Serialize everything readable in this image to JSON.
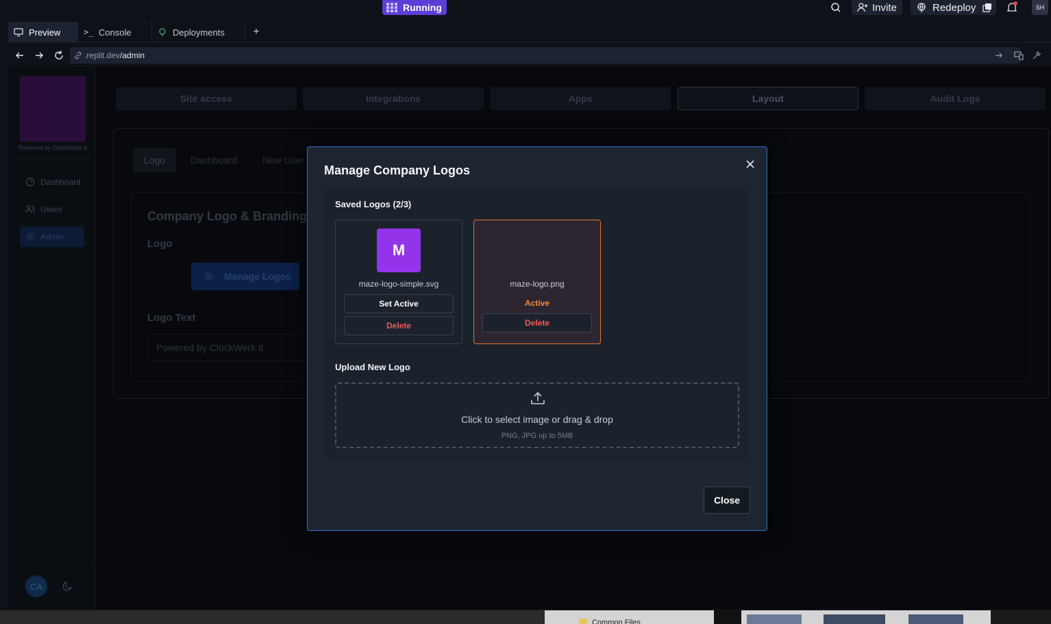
{
  "topbar": {
    "run_label": "Running",
    "invite_label": "Invite",
    "redeploy_label": "Redeploy",
    "avatar_initials": "SH"
  },
  "tabs": [
    {
      "label": "Preview",
      "icon": "monitor-icon"
    },
    {
      "label": "Console",
      "icon": "terminal-icon"
    },
    {
      "label": "Deployments",
      "icon": "deploy-icon"
    }
  ],
  "address": {
    "url_prefix": ".replit.dev",
    "url_path": "/admin"
  },
  "app": {
    "logo_caption": "Powered by ClockWerk.it",
    "nav": [
      {
        "label": "Dashboard"
      },
      {
        "label": "Users"
      },
      {
        "label": "Admin"
      }
    ],
    "admin_tabs": [
      "Site access",
      "Integrations",
      "Apps",
      "Layout",
      "Audit Logs"
    ],
    "layout_subtabs": [
      "Logo",
      "Dashboard",
      "New User"
    ],
    "branding_title": "Company Logo & Branding",
    "logo_heading": "Logo",
    "manage_logos_label": "Manage Logos",
    "logo_text_heading": "Logo Text",
    "logo_text_value": "Powered by ClockWerk.it",
    "user_initials": "CA"
  },
  "modal": {
    "title": "Manage Company Logos",
    "saved_heading": "Saved Logos (2/3)",
    "logos": [
      {
        "thumb_letter": "M",
        "filename": "maze-logo-simple.svg",
        "set_active_label": "Set Active",
        "delete_label": "Delete",
        "active": false
      },
      {
        "filename": "maze-logo.png",
        "status_label": "Active",
        "delete_label": "Delete",
        "active": true
      }
    ],
    "upload_heading": "Upload New Logo",
    "dropzone_text": "Click to select image or drag & drop",
    "dropzone_hint": "PNG, JPG up to 5MB",
    "close_label": "Close"
  },
  "taskbar": {
    "folder_label": "Common Files"
  },
  "colors": {
    "accent": "#2f6fd6",
    "active_orange": "#f08a3a",
    "delete_red": "#ef5a5a",
    "logo_purple": "#9333ea"
  }
}
